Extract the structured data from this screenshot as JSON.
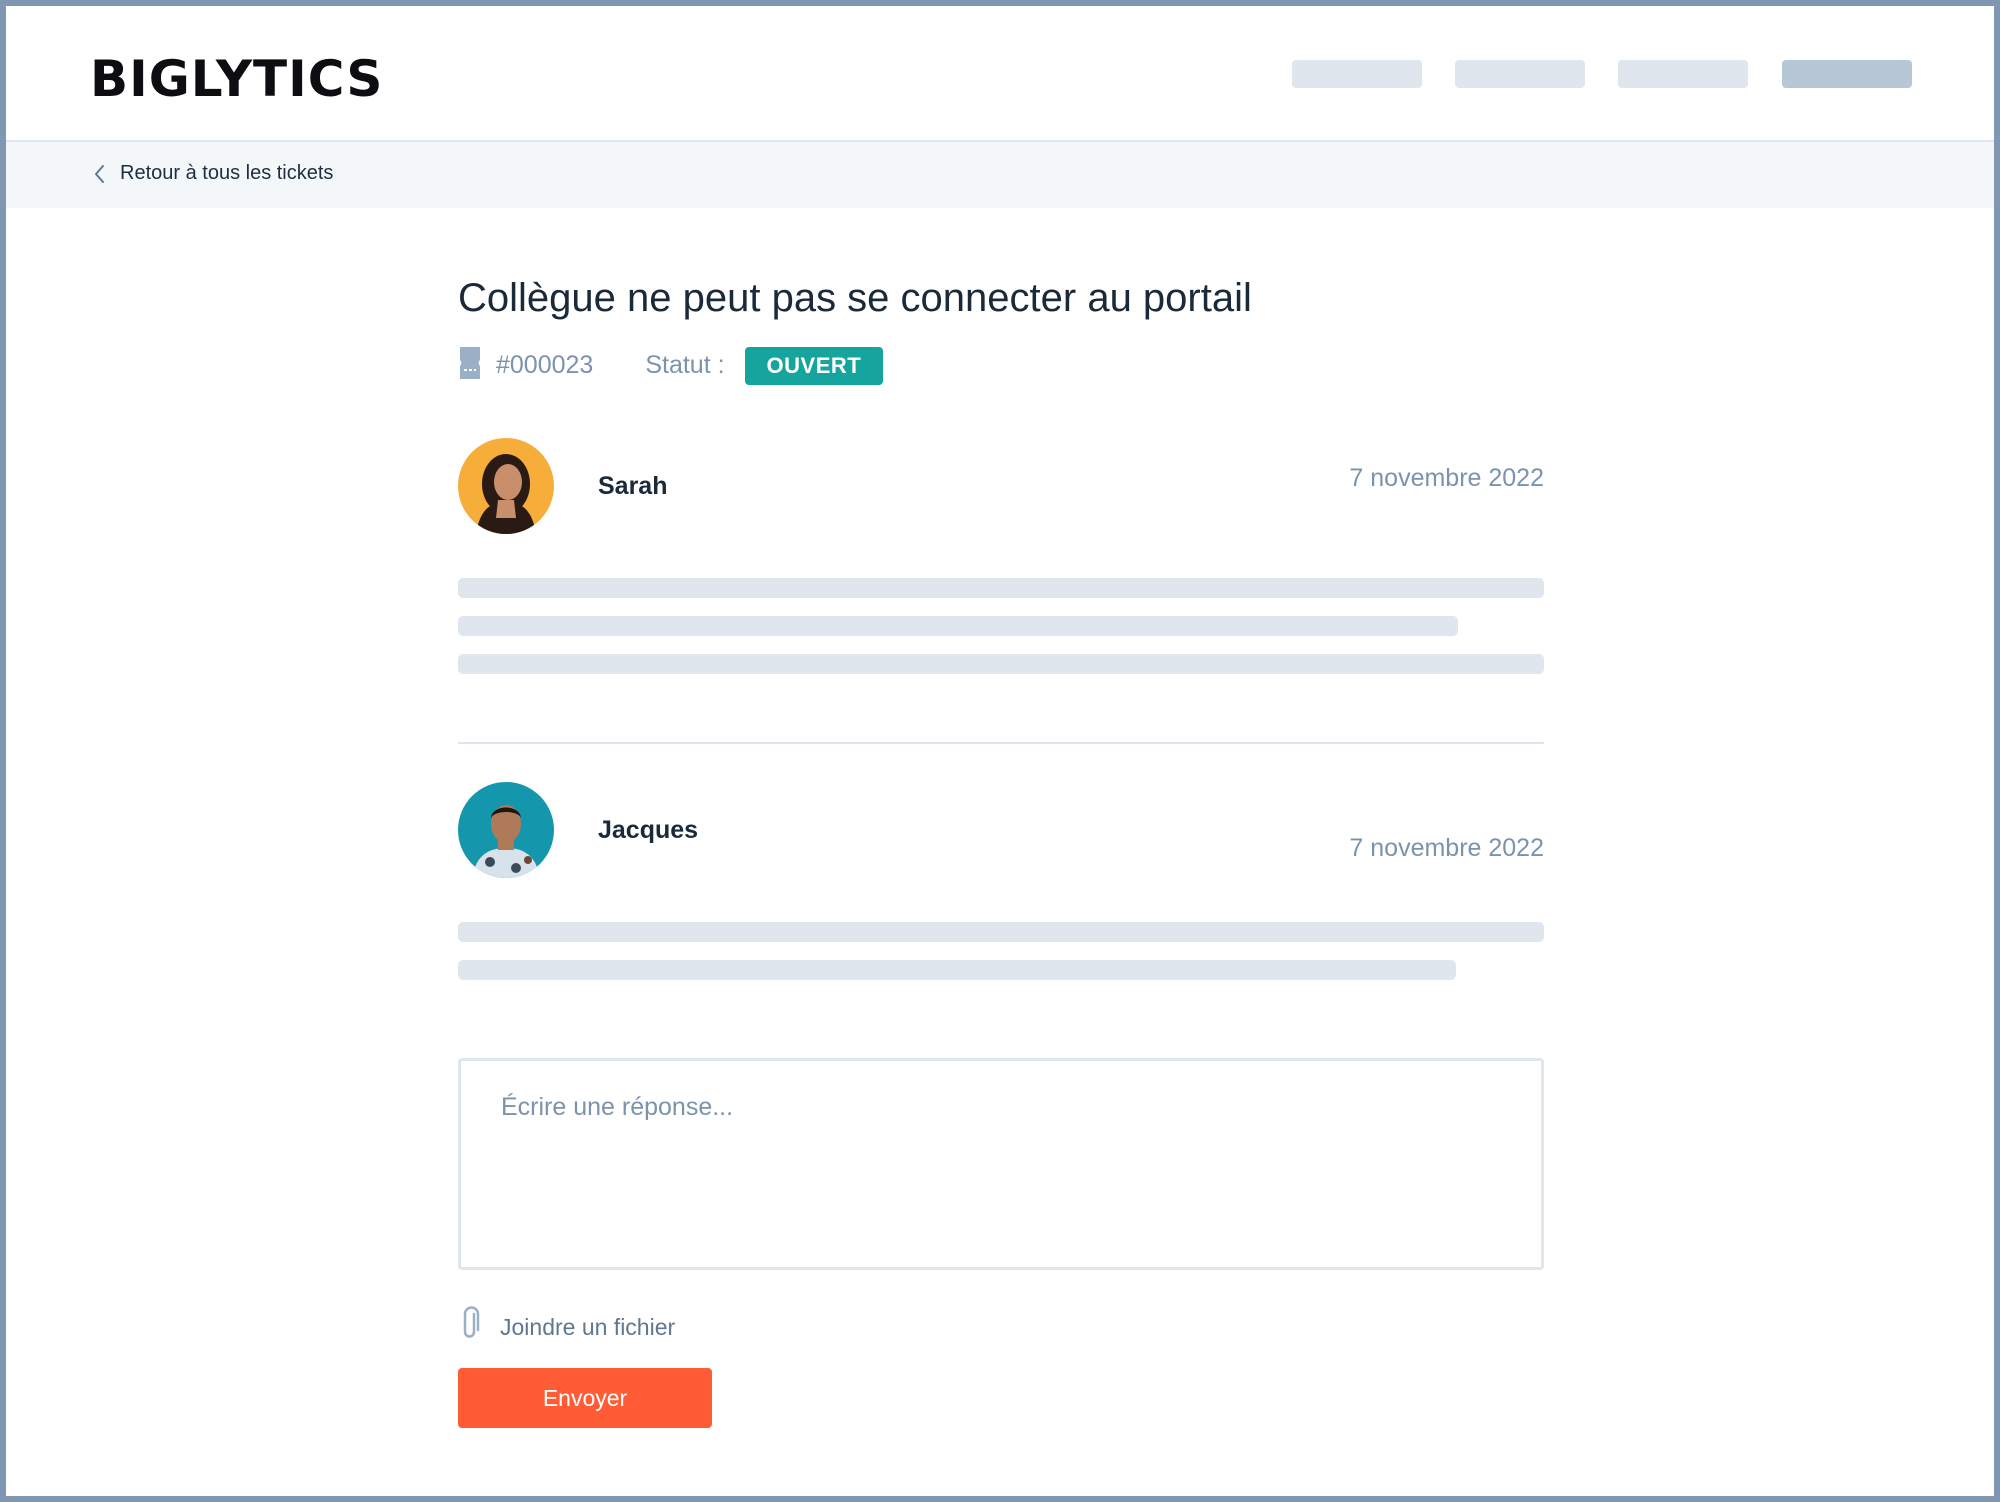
{
  "header": {
    "logo": "BIGLYTICS"
  },
  "breadcrumb": {
    "label": "Retour à tous les tickets"
  },
  "ticket": {
    "title": "Collègue ne peut pas se connecter au portail",
    "number": "#000023",
    "status_label": "Statut :",
    "status": "OUVERT"
  },
  "messages": [
    {
      "author": "Sarah",
      "date": "7 novembre 2022"
    },
    {
      "author": "Jacques",
      "date": "7 novembre 2022"
    }
  ],
  "reply": {
    "placeholder": "Écrire une réponse...",
    "attach_label": "Joindre un fichier",
    "send_label": "Envoyer"
  },
  "colors": {
    "accent": "#ff5c35",
    "status_open": "#16a49e",
    "frame": "#7f97b2"
  }
}
